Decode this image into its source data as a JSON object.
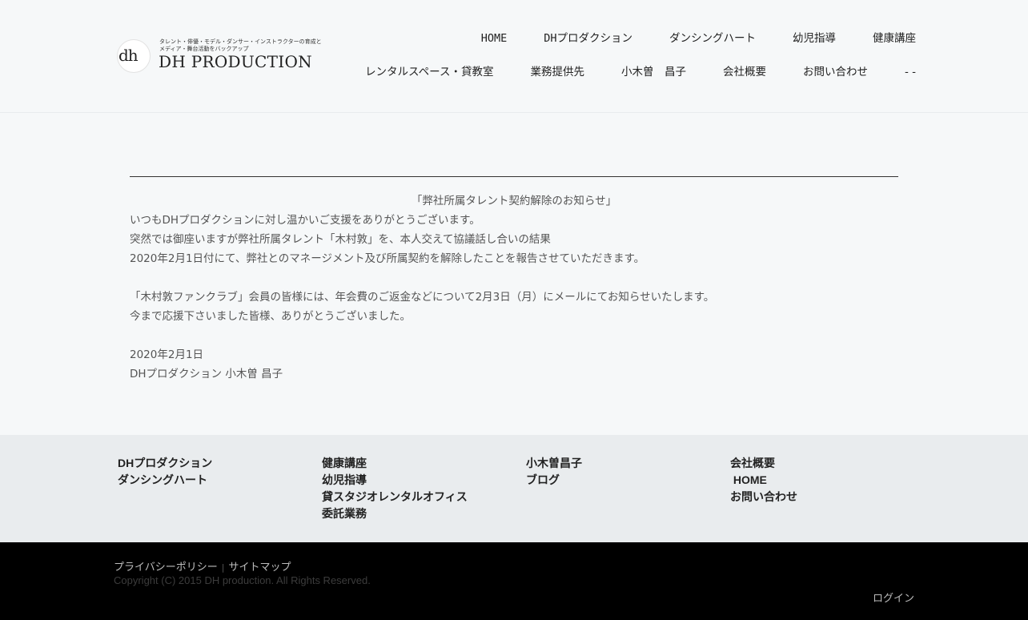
{
  "header": {
    "logo": {
      "mark": "dh",
      "tagline_1": "タレント・俳優・モデル・ダンサー・インストラクターの育成と",
      "tagline_2": "メディア・舞台活動をバックアップ",
      "name": "DH PRODUCTION"
    },
    "nav_row1": [
      {
        "label": "HOME"
      },
      {
        "label": "DHプロダクション"
      },
      {
        "label": "ダンシングハート"
      },
      {
        "label": "幼児指導"
      },
      {
        "label": "健康講座"
      }
    ],
    "nav_row2": [
      {
        "label": "レンタルスペース・貸教室"
      },
      {
        "label": "業務提供先"
      },
      {
        "label": "小木曽　昌子"
      },
      {
        "label": "会社概要"
      },
      {
        "label": "お問い合わせ"
      },
      {
        "label": "- -"
      }
    ]
  },
  "article": {
    "heading": "「弊社所属タレント契約解除のお知らせ」",
    "line1": "いつもDHプロダクションに対し温かいご支援をありがとうございます。",
    "line2": "突然では御座いますが弊社所属タレント「木村敦」を、本人交えて協議話し合いの結果",
    "line3": "2020年2月1日付にて、弊社とのマネージメント及び所属契約を解除したことを報告させていただきます。",
    "line4": "「木村敦ファンクラブ」会員の皆様には、年会費のご返金などについて2月3日（月）にメールにてお知らせいたします。",
    "line5": "今まで応援下さいました皆様、ありがとうございました。",
    "date": "2020年2月1日",
    "signature": "DHプロダクション 小木曽 昌子"
  },
  "footer_nav": {
    "col1": [
      "DHプロダクション",
      "ダンシングハート"
    ],
    "col2": [
      "健康講座",
      "幼児指導",
      "貸スタジオレンタルオフィス",
      "委託業務"
    ],
    "col3": [
      "小木曽昌子",
      "ブログ"
    ],
    "col4": [
      "会社概要",
      " HOME",
      "お問い合わせ"
    ]
  },
  "bottom": {
    "privacy": "プライバシーポリシー",
    "separator": "|",
    "sitemap": "サイトマップ",
    "copyright": "Copyright (C) 2015 DH production. All Rights Reserved.",
    "login": "ログイン"
  }
}
